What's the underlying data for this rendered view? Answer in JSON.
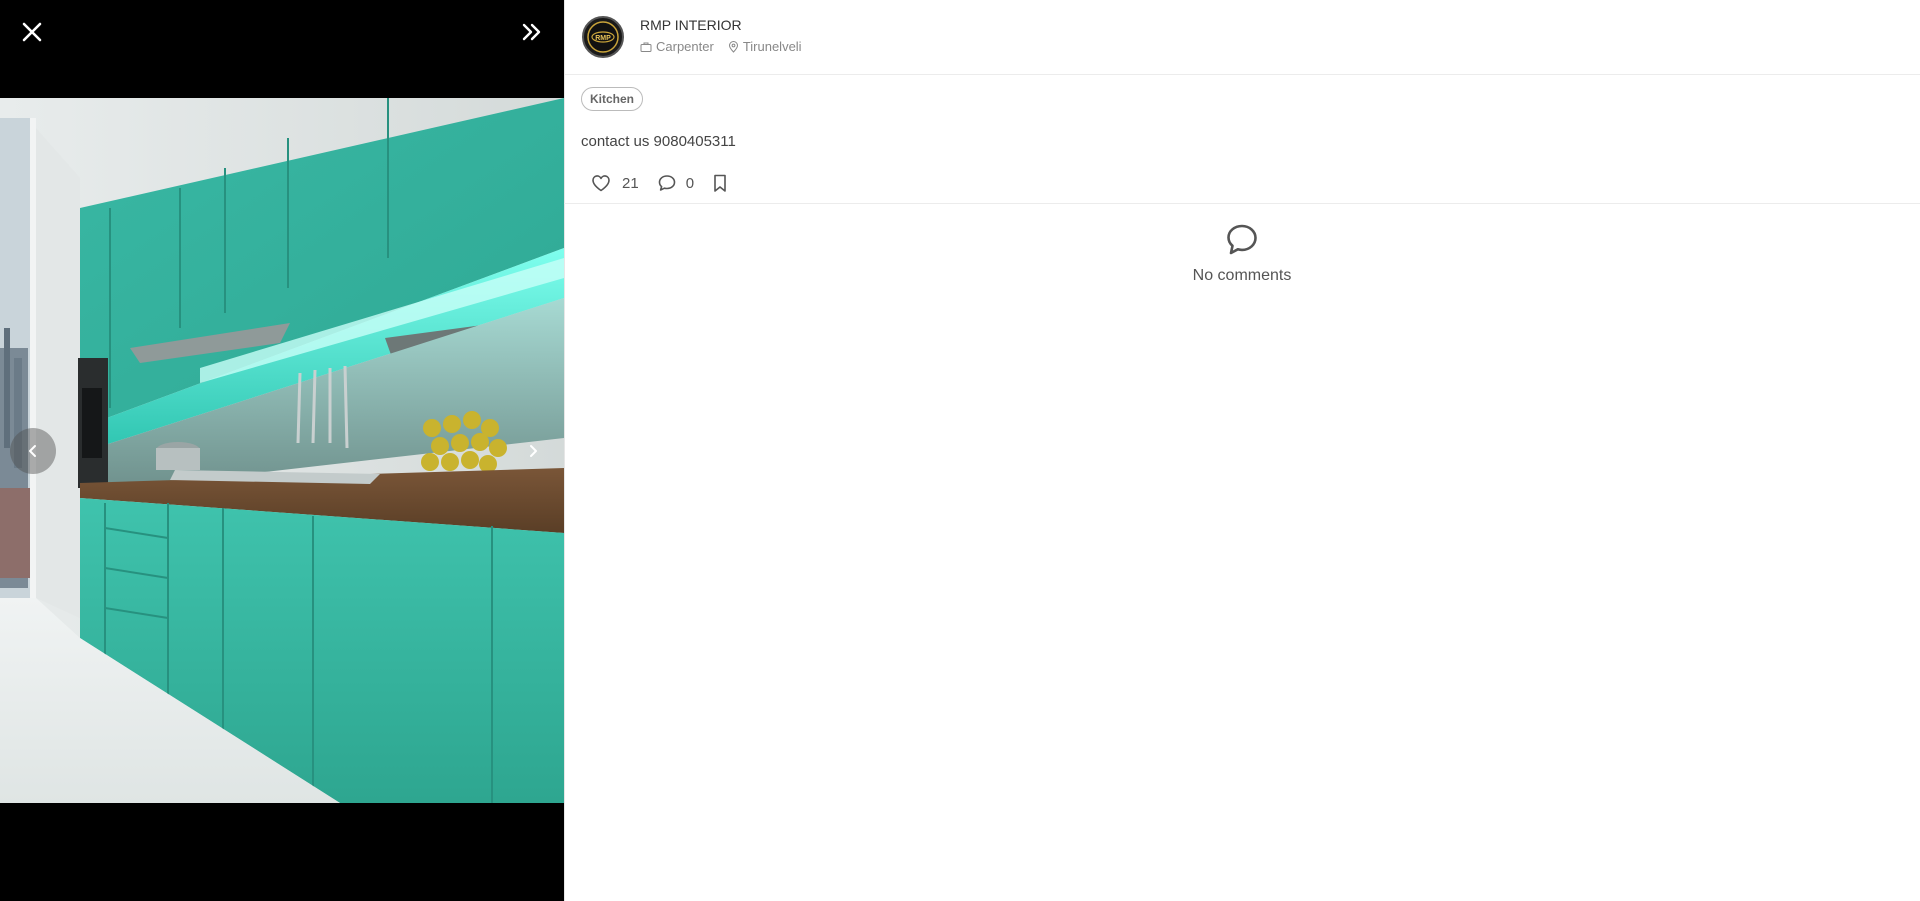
{
  "viewer": {
    "close_icon": "close-icon",
    "collapse_icon": "double-chevron-right-icon",
    "prev_icon": "chevron-left-icon",
    "next_icon": "chevron-right-icon",
    "accent_color": "#3ec9b4"
  },
  "author": {
    "name": "RMP INTERIOR",
    "profession": "Carpenter",
    "location": "Tirunelveli",
    "avatar_logo_text": "RMP"
  },
  "post": {
    "tag": "Kitchen",
    "text": "contact us 9080405311",
    "likes": "21",
    "comments": "0"
  },
  "comments": {
    "empty_label": "No comments"
  }
}
